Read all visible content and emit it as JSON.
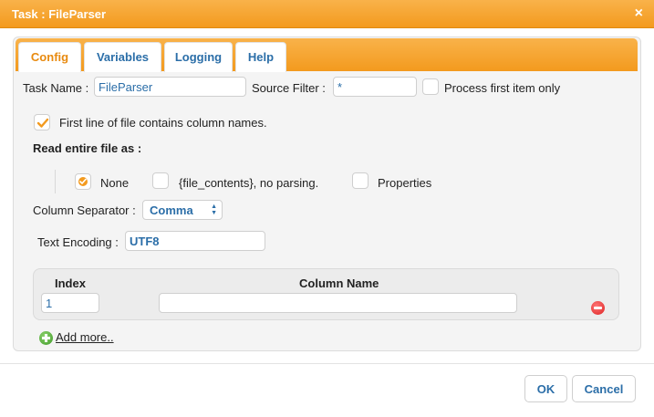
{
  "window": {
    "title": "Task : FileParser",
    "close_glyph": "×"
  },
  "tabs": [
    {
      "label": "Config",
      "active": true
    },
    {
      "label": "Variables",
      "active": false
    },
    {
      "label": "Logging",
      "active": false
    },
    {
      "label": "Help",
      "active": false
    }
  ],
  "config": {
    "task_name_label": "Task Name :",
    "task_name_value": "FileParser",
    "source_filter_label": "Source Filter :",
    "source_filter_value": "*",
    "process_first_label": "Process first item only",
    "process_first_checked": false,
    "first_line_label": "First line of file contains column names.",
    "first_line_checked": true,
    "read_entire_label": "Read entire file as :",
    "read_options": [
      {
        "label": "None",
        "selected": true
      },
      {
        "label": "{file_contents}, no parsing.",
        "selected": false
      },
      {
        "label": "Properties",
        "selected": false
      }
    ],
    "column_separator_label": "Column Separator :",
    "column_separator_value": "Comma",
    "text_encoding_label": "Text Encoding :",
    "text_encoding_value": "UTF8"
  },
  "columns_table": {
    "headers": {
      "index": "Index",
      "column_name": "Column Name"
    },
    "rows": [
      {
        "index": "1",
        "column_name": ""
      }
    ],
    "add_more_label": "Add more.."
  },
  "footer": {
    "ok_label": "OK",
    "cancel_label": "Cancel"
  },
  "colors": {
    "accent": "#f39a1e",
    "link": "#2b6ea8",
    "remove": "#d22222",
    "add": "#3e9a28"
  },
  "icons": {
    "close": "close-icon",
    "check": "check-icon",
    "remove": "remove-row-icon",
    "add": "add-icon"
  }
}
